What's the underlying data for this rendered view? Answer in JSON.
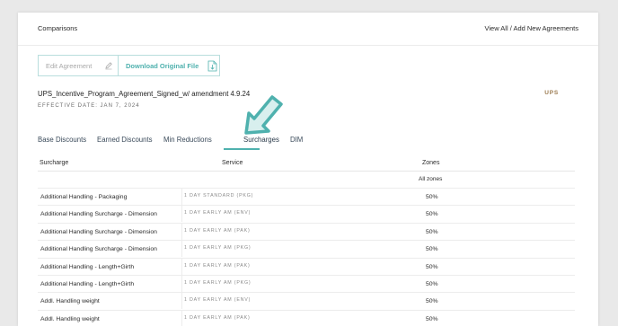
{
  "header": {
    "title": "Comparisons",
    "links": "View All / Add New Agreements"
  },
  "buttons": {
    "edit_label": "Edit Agreement",
    "download_label": "Download Original File"
  },
  "agreement": {
    "title": "UPS_Incentive_Program_Agreement_Signed_w/ amendment 4.9.24",
    "effective_date": "EFFECTIVE DATE: JAN 7, 2024",
    "carrier": "UPS"
  },
  "tabs": [
    {
      "label": "Base Discounts"
    },
    {
      "label": "Earned Discounts"
    },
    {
      "label": "Min Reductions"
    },
    {
      "label": "Surcharges",
      "active": true
    },
    {
      "label": "DIM"
    }
  ],
  "table": {
    "columns": [
      "Surcharge",
      "Service",
      "Zones"
    ],
    "subheader": "All zones",
    "rows": [
      {
        "surcharge": "Additional Handling - Packaging",
        "service": "1 DAY STANDARD (PKG)",
        "zones": "50%"
      },
      {
        "surcharge": "Additional Handling Surcharge - Dimension",
        "service": "1 DAY EARLY AM (ENV)",
        "zones": "50%"
      },
      {
        "surcharge": "Additional Handling Surcharge - Dimension",
        "service": "1 DAY EARLY AM (PAK)",
        "zones": "50%"
      },
      {
        "surcharge": "Additional Handling Surcharge - Dimension",
        "service": "1 DAY EARLY AM (PKG)",
        "zones": "50%"
      },
      {
        "surcharge": "Additional Handling - Length+Girth",
        "service": "1 DAY EARLY AM (PAK)",
        "zones": "50%"
      },
      {
        "surcharge": "Additional Handling - Length+Girth",
        "service": "1 DAY EARLY AM (PKG)",
        "zones": "50%"
      },
      {
        "surcharge": "Addl. Handling weight",
        "service": "1 DAY EARLY AM (ENV)",
        "zones": "50%"
      },
      {
        "surcharge": "Addl. Handling weight",
        "service": "1 DAY EARLY AM (PAK)",
        "zones": "50%"
      }
    ]
  },
  "colors": {
    "accent": "#4fb1ae",
    "carrier": "#9b7a4f",
    "arrow_fill": "#d8efee"
  }
}
